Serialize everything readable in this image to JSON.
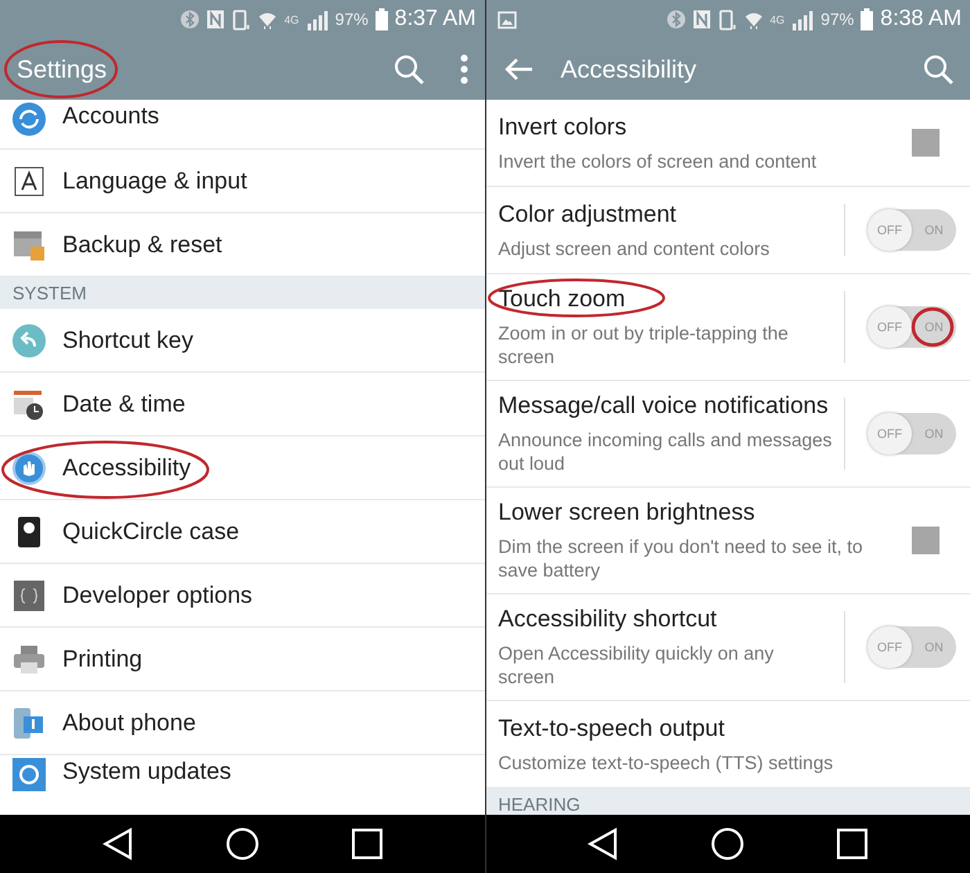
{
  "screens": [
    {
      "status_bar": {
        "notification": false,
        "network": "4G",
        "battery": "97%",
        "time": "8:37 AM"
      },
      "app_bar": {
        "title": "Settings",
        "title_circled": true,
        "back": false,
        "menu": true
      },
      "list": [
        {
          "kind": "item",
          "title": "Accounts",
          "circled": false
        },
        {
          "kind": "item",
          "title": "Language & input",
          "circled": false
        },
        {
          "kind": "item",
          "title": "Backup & reset",
          "circled": false
        },
        {
          "kind": "header",
          "title": "SYSTEM"
        },
        {
          "kind": "item",
          "title": "Shortcut key",
          "circled": false
        },
        {
          "kind": "item",
          "title": "Date & time",
          "circled": false
        },
        {
          "kind": "item",
          "title": "Accessibility",
          "circled": true
        },
        {
          "kind": "item",
          "title": "QuickCircle case",
          "circled": false
        },
        {
          "kind": "item",
          "title": "Developer options",
          "circled": false
        },
        {
          "kind": "item",
          "title": "Printing",
          "circled": false
        },
        {
          "kind": "item",
          "title": "About phone",
          "circled": false
        },
        {
          "kind": "item",
          "title": "System updates",
          "circled": false
        }
      ]
    },
    {
      "status_bar": {
        "notification": true,
        "network": "4G",
        "battery": "97%",
        "time": "8:38 AM"
      },
      "app_bar": {
        "title": "Accessibility",
        "title_circled": false,
        "back": true,
        "menu": false
      },
      "list": [
        {
          "kind": "checkbox",
          "title": "Invert colors",
          "summary": "Invert the colors of screen and content",
          "checked": false,
          "circled": false
        },
        {
          "kind": "toggle",
          "title": "Color adjustment",
          "summary": "Adjust screen and content colors",
          "on": false,
          "off_label": "OFF",
          "on_label": "ON",
          "circled": false,
          "toggle_circled": false
        },
        {
          "kind": "toggle",
          "title": "Touch zoom",
          "summary": "Zoom in or out by triple-tapping the screen",
          "on": false,
          "off_label": "OFF",
          "on_label": "ON",
          "circled": true,
          "toggle_circled": true
        },
        {
          "kind": "toggle",
          "title": "Message/call voice notifications",
          "summary": "Announce incoming calls and messages out loud",
          "on": false,
          "off_label": "OFF",
          "on_label": "ON",
          "circled": false,
          "toggle_circled": false
        },
        {
          "kind": "checkbox",
          "title": "Lower screen brightness",
          "summary": "Dim the screen if you don't need to see it, to save battery",
          "checked": false,
          "circled": false
        },
        {
          "kind": "toggle",
          "title": "Accessibility shortcut",
          "summary": "Open Accessibility quickly on any screen",
          "on": false,
          "off_label": "OFF",
          "on_label": "ON",
          "circled": false,
          "toggle_circled": false
        },
        {
          "kind": "plain",
          "title": "Text-to-speech output",
          "summary": "Customize text-to-speech (TTS) settings",
          "circled": false
        },
        {
          "kind": "header",
          "title": "HEARING"
        }
      ]
    }
  ]
}
